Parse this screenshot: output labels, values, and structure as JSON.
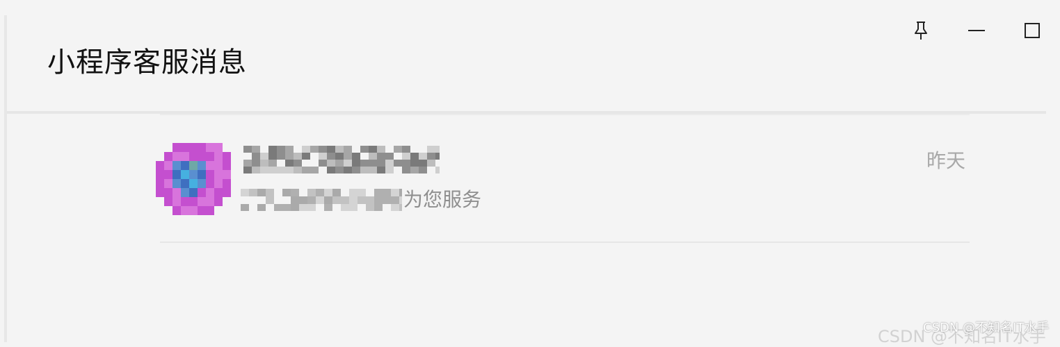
{
  "window": {
    "title": "小程序客服消息",
    "controls": [
      {
        "name": "pin-icon"
      },
      {
        "name": "minimize-icon"
      },
      {
        "name": "maximize-icon"
      }
    ]
  },
  "session": {
    "time": "昨天",
    "preview_visible_text": "为您服务"
  },
  "watermark": {
    "text": "CSDN @不知名IT水手"
  },
  "colors": {
    "background": "#f4f4f4",
    "title_text": "#111111",
    "secondary_text": "#8f8f8f",
    "time_text": "#a8a8a8",
    "divider": "#e6e6e6",
    "avatar_accent": "#c44fcf"
  }
}
